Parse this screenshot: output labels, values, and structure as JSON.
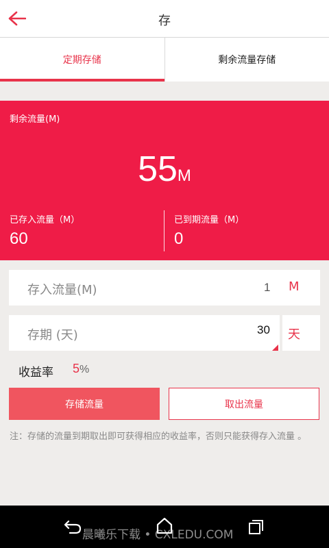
{
  "header": {
    "title": "存",
    "back_icon": "back-arrow-icon",
    "accent_color": "#e8334a"
  },
  "tabs": [
    {
      "label": "定期存储",
      "active": true
    },
    {
      "label": "剩余流量存储",
      "active": false
    }
  ],
  "summary": {
    "remaining_label": "剩余流量(M)",
    "remaining_value": "55",
    "remaining_unit": "M",
    "deposited_label": "已存入流量（M）",
    "deposited_value": "60",
    "expired_label": "已到期流量（M）",
    "expired_value": "0",
    "background_color": "#ef1c47"
  },
  "form": {
    "deposit": {
      "label": "存入流量(M)",
      "value": "1",
      "unit": "M"
    },
    "period": {
      "label": "存期 (天)",
      "value": "30",
      "unit": "天"
    }
  },
  "rate": {
    "label": "收益率",
    "value": "5",
    "percent": "%"
  },
  "buttons": {
    "store": "存储流量",
    "withdraw": "取出流量"
  },
  "note": "注：存储的流量到期取出即可获得相应的收益率，否则只能获得存入流量 。",
  "navbar": {
    "watermark": "晨曦乐下载 • CXLEDU.COM"
  }
}
